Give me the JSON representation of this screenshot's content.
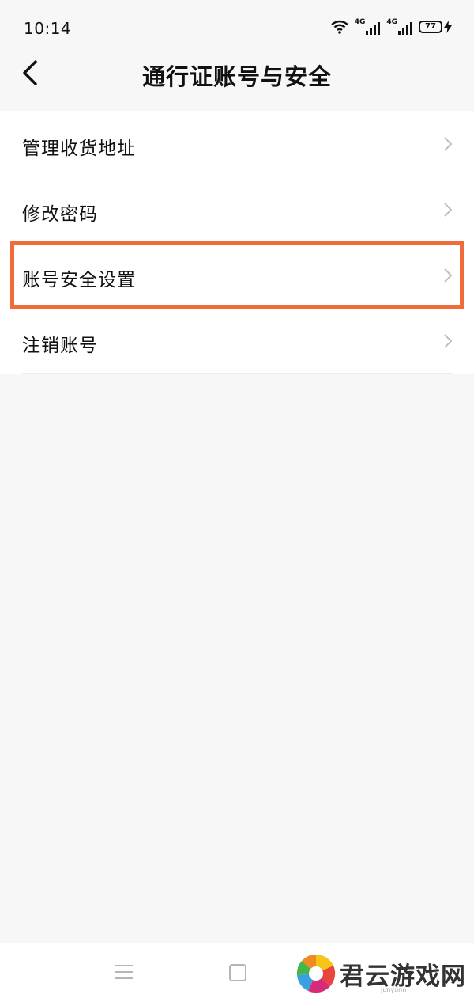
{
  "status_bar": {
    "time": "10:14",
    "network_1": "4G",
    "network_2": "4G",
    "battery": "77",
    "icons": [
      "wifi-icon",
      "signal-icon",
      "signal-icon",
      "battery-icon",
      "charging-icon"
    ]
  },
  "header": {
    "title": "通行证账号与安全",
    "back_icon": "back-chevron-icon"
  },
  "menu": {
    "items": [
      {
        "label": "管理收货地址",
        "highlighted": false
      },
      {
        "label": "修改密码",
        "highlighted": false
      },
      {
        "label": "账号安全设置",
        "highlighted": true
      },
      {
        "label": "注销账号",
        "highlighted": false
      }
    ],
    "highlight_color": "#f26b3a"
  },
  "nav_bar": {
    "icons": [
      "menu-icon",
      "home-icon"
    ]
  },
  "watermark": {
    "text": "君云游戏网",
    "sub": "junyunn"
  }
}
